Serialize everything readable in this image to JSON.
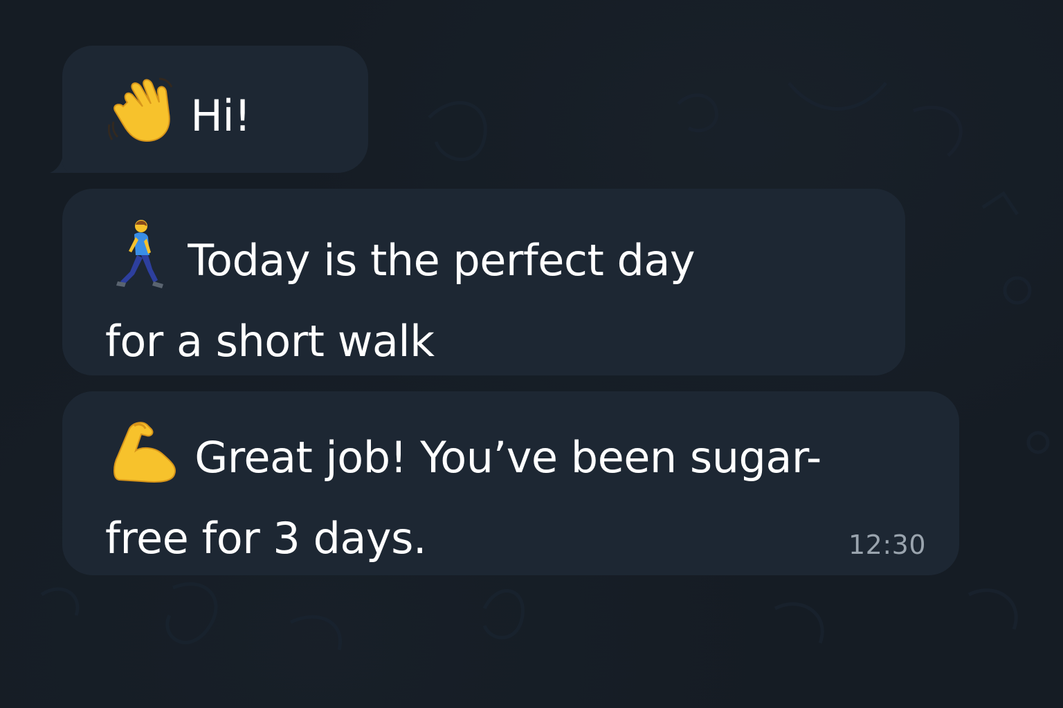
{
  "messages": [
    {
      "icon": "waving-hand-icon",
      "lines": [
        "Hi!"
      ]
    },
    {
      "icon": "walking-person-icon",
      "lines": [
        "Today is the perfect day",
        "for a short walk"
      ]
    },
    {
      "icon": "flexed-biceps-icon",
      "lines": [
        "Great job! You’ve been sugar-",
        "free for 3 days."
      ],
      "time": "12:30"
    }
  ],
  "colors": {
    "background": "#151c24",
    "bubble": "#1d2733",
    "text": "#ffffff",
    "timestamp": "#9aa4ae"
  }
}
